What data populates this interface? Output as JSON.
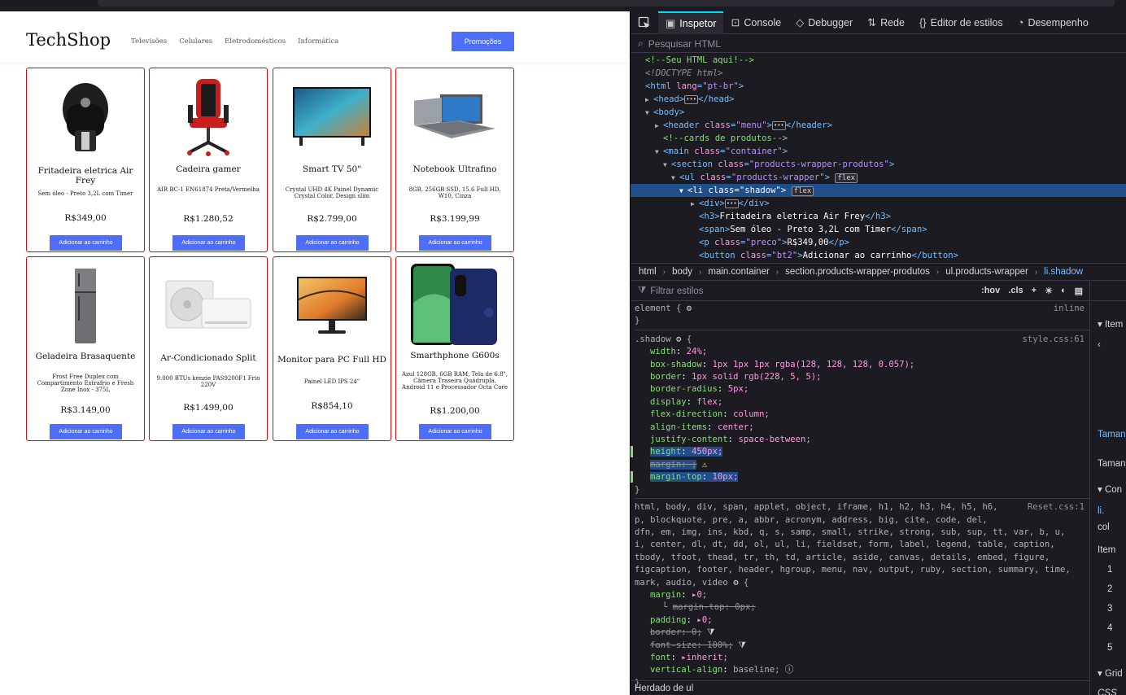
{
  "site": {
    "logo": "TechShop",
    "nav": [
      "Televisões",
      "Celulares",
      "Eletrodomésticos",
      "Informática"
    ],
    "promo_button": "Promoções",
    "products": [
      {
        "name": "Fritadeira eletrica Air Frey",
        "desc": "Sem óleo - Preto 3,2L com Timer",
        "price": "R$349,00",
        "button": "Adicionar ao carrinho",
        "icon": "air-fryer-image"
      },
      {
        "name": "Cadeira gamer",
        "desc": "AIR BC-1 EN61874 Preta/Vermelha",
        "price": "R$1.280,52",
        "button": "Adicionar ao carrinho",
        "icon": "gamer-chair-image"
      },
      {
        "name": "Smart TV 50\"",
        "desc": "Crystal UHD 4K Painel Dynamic Crystal Color, Design slim",
        "price": "R$2.799,00",
        "button": "Adicionar ao carrinho",
        "icon": "smart-tv-image"
      },
      {
        "name": "Notebook Ultrafino",
        "desc": "8GB, 256GB SSD, 15.6 Full HD, W10, Cinza",
        "price": "R$3.199,99",
        "button": "Adicionar ao carrinho",
        "icon": "notebook-image"
      },
      {
        "name": "Geladeira Brasaquente",
        "desc": "Frost Free Duplex com Compartimento Extrafrio e Fresh Zone Inox - 375L",
        "price": "R$3.149,00",
        "button": "Adicionar ao carrinho",
        "icon": "refrigerator-image"
      },
      {
        "name": "Ar-Condicionado Split",
        "desc": "9.000 BTUs kenzie PAS9200F1 Frio 220V",
        "price": "R$1.499,00",
        "button": "Adicionar ao carrinho",
        "icon": "air-conditioner-image"
      },
      {
        "name": "Monitor para PC Full HD",
        "desc": "Painel LED IPS 24\"",
        "price": "R$854,10",
        "button": "Adicionar ao carrinho",
        "icon": "monitor-image"
      },
      {
        "name": "Smarthphone G600s",
        "desc": "Azul 128GB, 6GB RAM, Tela de 6.8\", Câmera Traseira Quádrupla, Android 11 e Processador Octa Core",
        "price": "R$1.200,00",
        "button": "Adicionar ao carrinho",
        "icon": "smartphone-image"
      }
    ]
  },
  "devtools": {
    "tabs": [
      "Inspetor",
      "Console",
      "Debugger",
      "Rede",
      "Editor de estilos",
      "Desempenho"
    ],
    "search_placeholder": "Pesquisar HTML",
    "tree": {
      "comment1": "<!--Seu HTML aqui!-->",
      "doctype": "<!DOCTYPE html>",
      "html_open": "<html",
      "lang_attr": "lang",
      "lang_val": "\"pt-br\"",
      "head": "<head>",
      "head_close": "</head>",
      "body": "<body>",
      "header_open": "<header",
      "class_attr": "class",
      "menu_val": "\"menu\"",
      "header_close": "</header>",
      "comment2": "<!--cards de produtos-->",
      "main_open": "<main",
      "container_val": "\"container\"",
      "section_open": "<section",
      "section_val": "\"products-wrapper-produtos\"",
      "ul_open": "<ul",
      "ul_val": "\"products-wrapper\"",
      "flex_badge": "flex",
      "li_open": "<li",
      "li_val": "\"shadow\"",
      "div_open": "<div>",
      "div_close": "</div>",
      "h3_open": "<h3>",
      "h3_text": "Fritadeira eletrica Air Frey",
      "h3_close": "</h3>",
      "span_open": "<span>",
      "span_text": "Sem óleo - Preto 3,2L com Timer",
      "span_close": "</span>",
      "p_open": "<p",
      "p_val": "\"preco\"",
      "p_text": "R$349,00",
      "p_close": "</p>",
      "button_open": "<button",
      "button_val": "\"bt2\"",
      "button_text": "Adicionar ao carrinho",
      "button_close": "</button>"
    },
    "breadcrumbs": [
      "html",
      "body",
      "main.container",
      "section.products-wrapper-produtos",
      "ul.products-wrapper",
      "li.shadow"
    ],
    "filter_placeholder": "Filtrar estilos",
    "hov": ":hov",
    "cls": ".cls",
    "element_rule": "element {",
    "inline": "inline",
    "shadow_selector": ".shadow",
    "shadow_source": "style.css:61",
    "shadow_props": [
      {
        "p": "width",
        "v": "24%;"
      },
      {
        "p": "box-shadow",
        "v": "1px 1px 1px rgba(128, 128, 128, 0.057);"
      },
      {
        "p": "border",
        "v": "1px solid rgb(228, 5, 5);"
      },
      {
        "p": "border-radius",
        "v": "5px;"
      },
      {
        "p": "display",
        "v": "flex;"
      },
      {
        "p": "flex-direction",
        "v": "column;"
      },
      {
        "p": "align-items",
        "v": "center;"
      },
      {
        "p": "justify-content",
        "v": "space-between;"
      }
    ],
    "height_prop": "height",
    "height_val": "450px;",
    "margin_prop": "margin",
    "margin_val": ";",
    "margintop_prop": "margin-top",
    "margintop_val": "10px;",
    "reset_selector": "html, body, div, span, applet, object, iframe, h1, h2, h3, h4, h5, h6,",
    "reset_selector2": "p, blockquote, pre, a, abbr, acronym, address, big, cite, code, del,",
    "reset_selector3": "dfn, em, img, ins, kbd, q, s, samp, small, strike, strong, sub, sup, tt, var, b, u,",
    "reset_selector4": "i, center, dl, dt, dd, ol, ul, li, fieldset, form, label, legend, table, caption,",
    "reset_selector5": "tbody, tfoot, thead, tr, th, td, article, aside, canvas, details, embed, figure,",
    "reset_selector6": "figcaption, footer, header, hgroup, menu, nav, output, ruby, section, summary, time,",
    "reset_selector7": "mark, audio, video",
    "reset_source": "Reset.css:1",
    "reset_margin": "margin",
    "reset_margin_val": "0;",
    "reset_margintop": "margin-top: 0px;",
    "reset_padding": "padding",
    "reset_padding_val": "0;",
    "reset_border": "border: 0;",
    "reset_fontsize": "font-size: 100%;",
    "reset_font": "font",
    "reset_font_val": "inherit;",
    "reset_valign": "vertical-align",
    "reset_valign_val": "baseline;",
    "inherited": "Herdado de ul",
    "side_items": [
      "Item",
      "Taman",
      "Taman",
      "Con",
      "li.",
      "col",
      "Item",
      "1",
      "2",
      "3",
      "4",
      "5",
      "Grid",
      "CSS"
    ]
  }
}
